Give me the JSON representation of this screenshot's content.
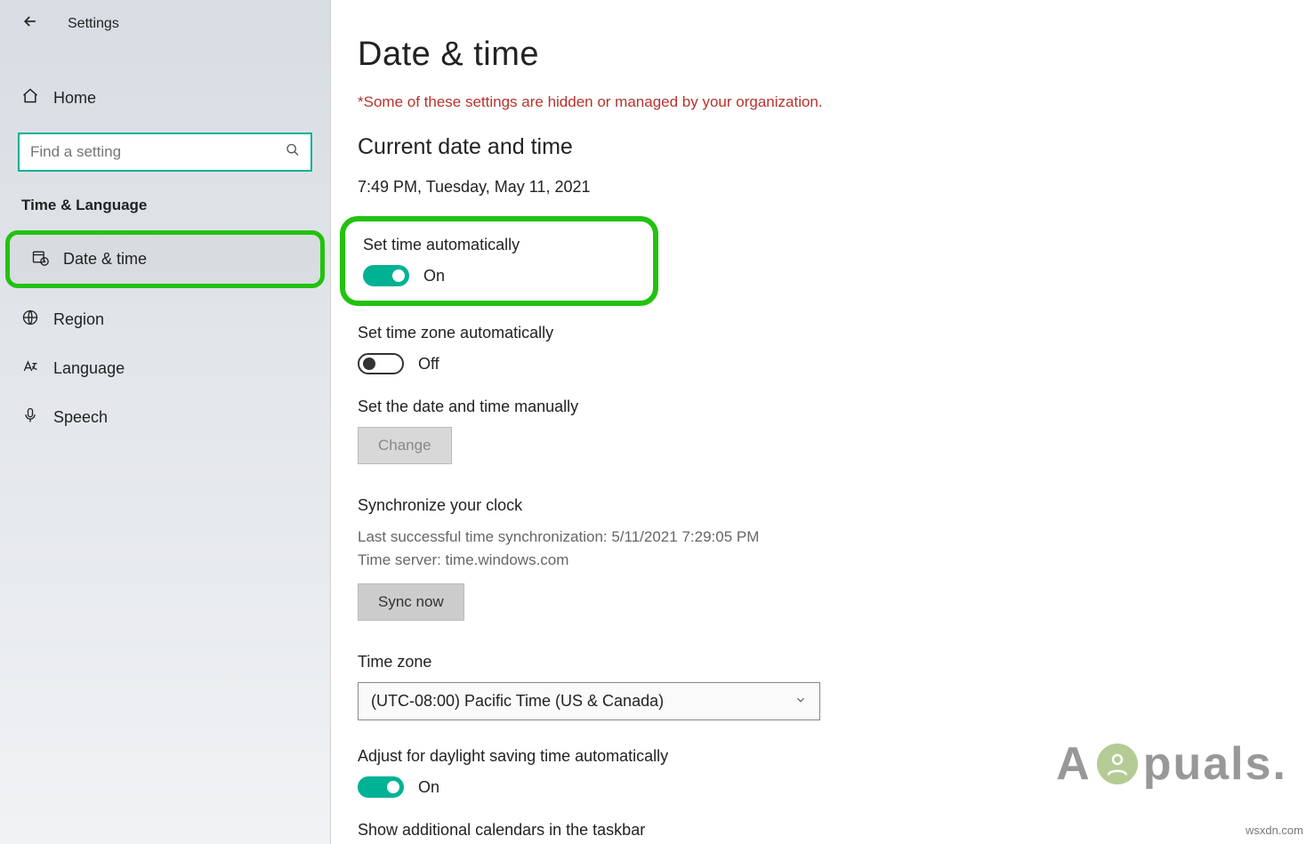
{
  "header": {
    "title": "Settings"
  },
  "sidebar": {
    "home_label": "Home",
    "search_placeholder": "Find a setting",
    "section_title": "Time & Language",
    "items": [
      {
        "label": "Date & time"
      },
      {
        "label": "Region"
      },
      {
        "label": "Language"
      },
      {
        "label": "Speech"
      }
    ]
  },
  "main": {
    "title": "Date & time",
    "warning": "*Some of these settings are hidden or managed by your organization.",
    "current_heading": "Current date and time",
    "current_value": "7:49 PM, Tuesday, May 11, 2021",
    "set_time_auto": {
      "label": "Set time automatically",
      "state": "On"
    },
    "set_tz_auto": {
      "label": "Set time zone automatically",
      "state": "Off"
    },
    "manual": {
      "label": "Set the date and time manually",
      "button": "Change"
    },
    "sync": {
      "heading": "Synchronize your clock",
      "last_sync": "Last successful time synchronization: 5/11/2021 7:29:05 PM",
      "server": "Time server: time.windows.com",
      "button": "Sync now"
    },
    "timezone": {
      "label": "Time zone",
      "value": "(UTC-08:00) Pacific Time (US & Canada)"
    },
    "dst": {
      "label": "Adjust for daylight saving time automatically",
      "state": "On"
    },
    "additional_cal": "Show additional calendars in the taskbar"
  },
  "watermark": {
    "text_prefix": "A",
    "text_suffix": "puals."
  },
  "credit": "wsxdn.com"
}
